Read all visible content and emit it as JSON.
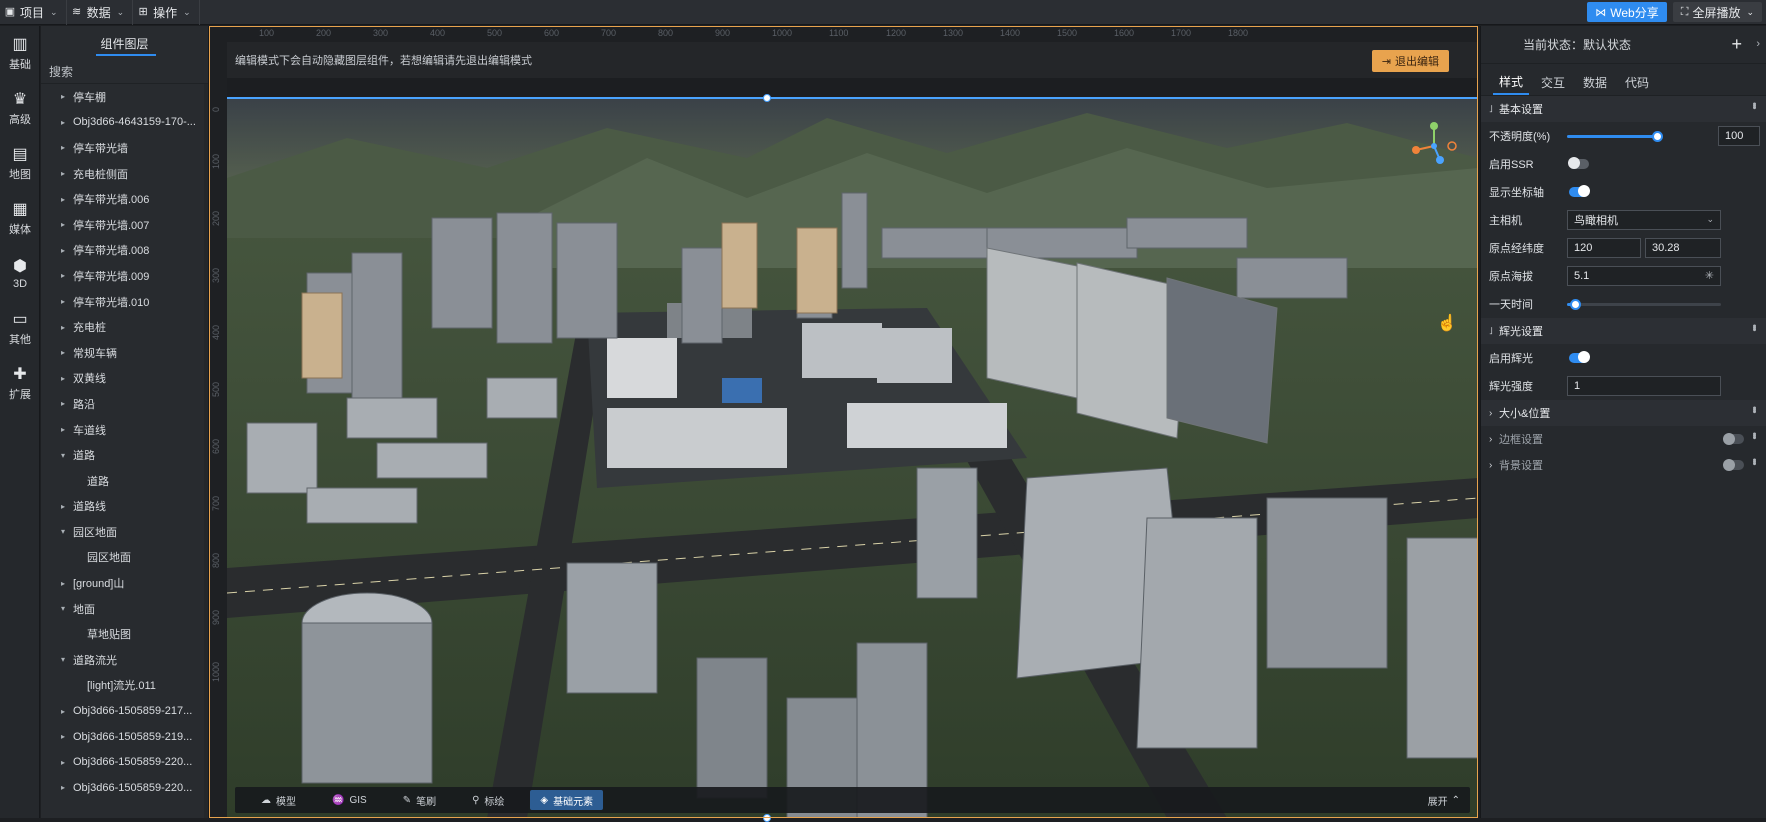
{
  "topbar": {
    "menus": [
      {
        "label": "项目",
        "icon": "project-icon"
      },
      {
        "label": "数据",
        "icon": "database-icon"
      },
      {
        "label": "操作",
        "icon": "grid-icon"
      }
    ],
    "share_label": "Web分享",
    "fullscreen_label": "全屏播放"
  },
  "rail": {
    "items": [
      {
        "label": "基础",
        "icon": "chart-icon"
      },
      {
        "label": "高级",
        "icon": "crown-icon"
      },
      {
        "label": "地图",
        "icon": "map-icon"
      },
      {
        "label": "媒体",
        "icon": "media-icon"
      },
      {
        "label": "3D",
        "icon": "cube-icon"
      },
      {
        "label": "其他",
        "icon": "document-icon"
      },
      {
        "label": "扩展",
        "icon": "puzzle-icon"
      }
    ]
  },
  "layers": {
    "title": "组件图层",
    "search_placeholder": "搜索",
    "items": [
      {
        "label": "停车棚",
        "caret": "▸",
        "child": false
      },
      {
        "label": "Obj3d66-4643159-170-...",
        "caret": "▸",
        "child": false
      },
      {
        "label": "停车带光墙",
        "caret": "▸",
        "child": false
      },
      {
        "label": "充电桩侧面",
        "caret": "▸",
        "child": false
      },
      {
        "label": "停车带光墙.006",
        "caret": "▸",
        "child": false
      },
      {
        "label": "停车带光墙.007",
        "caret": "▸",
        "child": false
      },
      {
        "label": "停车带光墙.008",
        "caret": "▸",
        "child": false
      },
      {
        "label": "停车带光墙.009",
        "caret": "▸",
        "child": false
      },
      {
        "label": "停车带光墙.010",
        "caret": "▸",
        "child": false
      },
      {
        "label": "充电桩",
        "caret": "▸",
        "child": false
      },
      {
        "label": "常规车辆",
        "caret": "▸",
        "child": false
      },
      {
        "label": "双黄线",
        "caret": "▸",
        "child": false
      },
      {
        "label": "路沿",
        "caret": "▸",
        "child": false
      },
      {
        "label": "车道线",
        "caret": "▸",
        "child": false
      },
      {
        "label": "道路",
        "caret": "▾",
        "child": false
      },
      {
        "label": "道路",
        "caret": "",
        "child": true
      },
      {
        "label": "道路线",
        "caret": "▸",
        "child": false
      },
      {
        "label": "园区地面",
        "caret": "▾",
        "child": false
      },
      {
        "label": "园区地面",
        "caret": "",
        "child": true
      },
      {
        "label": "[ground]山",
        "caret": "▸",
        "child": false
      },
      {
        "label": "地面",
        "caret": "▾",
        "child": false
      },
      {
        "label": "草地贴图",
        "caret": "",
        "child": true
      },
      {
        "label": "道路流光",
        "caret": "▾",
        "child": false
      },
      {
        "label": "[light]流光.011",
        "caret": "",
        "child": true
      },
      {
        "label": "Obj3d66-1505859-217...",
        "caret": "▸",
        "child": false
      },
      {
        "label": "Obj3d66-1505859-219...",
        "caret": "▸",
        "child": false
      },
      {
        "label": "Obj3d66-1505859-220...",
        "caret": "▸",
        "child": false
      },
      {
        "label": "Obj3d66-1505859-220...",
        "caret": "▸",
        "child": false
      }
    ]
  },
  "stage": {
    "ruler_top": [
      "100",
      "200",
      "300",
      "400",
      "500",
      "600",
      "700",
      "800",
      "900",
      "1000",
      "1100",
      "1200",
      "1300",
      "1400",
      "1500",
      "1600",
      "1700",
      "1800"
    ],
    "ruler_left": [
      "0",
      "100",
      "200",
      "300",
      "400",
      "500",
      "600",
      "700",
      "800",
      "900",
      "1000"
    ],
    "notice": "编辑模式下会自动隐藏图层组件，若想编辑请先退出编辑模式",
    "exit_label": "退出编辑",
    "toolbar": [
      {
        "label": "模型",
        "icon": "model-icon",
        "active": false
      },
      {
        "label": "GIS",
        "icon": "gis-icon",
        "active": false
      },
      {
        "label": "笔刷",
        "icon": "brush-icon",
        "active": false
      },
      {
        "label": "标绘",
        "icon": "pin-icon",
        "active": false
      },
      {
        "label": "基础元素",
        "icon": "element-icon",
        "active": true
      }
    ],
    "expand_label": "展开"
  },
  "props": {
    "state_label": "当前状态：默认状态",
    "tabs": [
      {
        "label": "样式",
        "active": true
      },
      {
        "label": "交互",
        "active": false
      },
      {
        "label": "数据",
        "active": false
      },
      {
        "label": "代码",
        "active": false
      }
    ],
    "basic": {
      "title": "基本设置",
      "opacity_label": "不透明度(%)",
      "opacity_value": "100",
      "opacity_fraction": 1.0,
      "ssr_label": "启用SSR",
      "ssr_on": false,
      "axis_label": "显示坐标轴",
      "axis_on": true,
      "camera_label": "主相机",
      "camera_value": "鸟瞰相机",
      "lnglat_label": "原点经纬度",
      "lng_value": "120",
      "lat_value": "30.28",
      "alt_label": "原点海拔",
      "alt_value": "5.1",
      "time_label": "一天时间",
      "time_fraction": 0.05
    },
    "glow": {
      "title": "辉光设置",
      "enable_label": "启用辉光",
      "enable_on": true,
      "intensity_label": "辉光强度",
      "intensity_value": "1"
    },
    "size_title": "大小&位置",
    "border_title": "边框设置",
    "background_title": "背景设置"
  },
  "colors": {
    "accent": "#2f8cf0",
    "warning": "#e8a34e"
  }
}
